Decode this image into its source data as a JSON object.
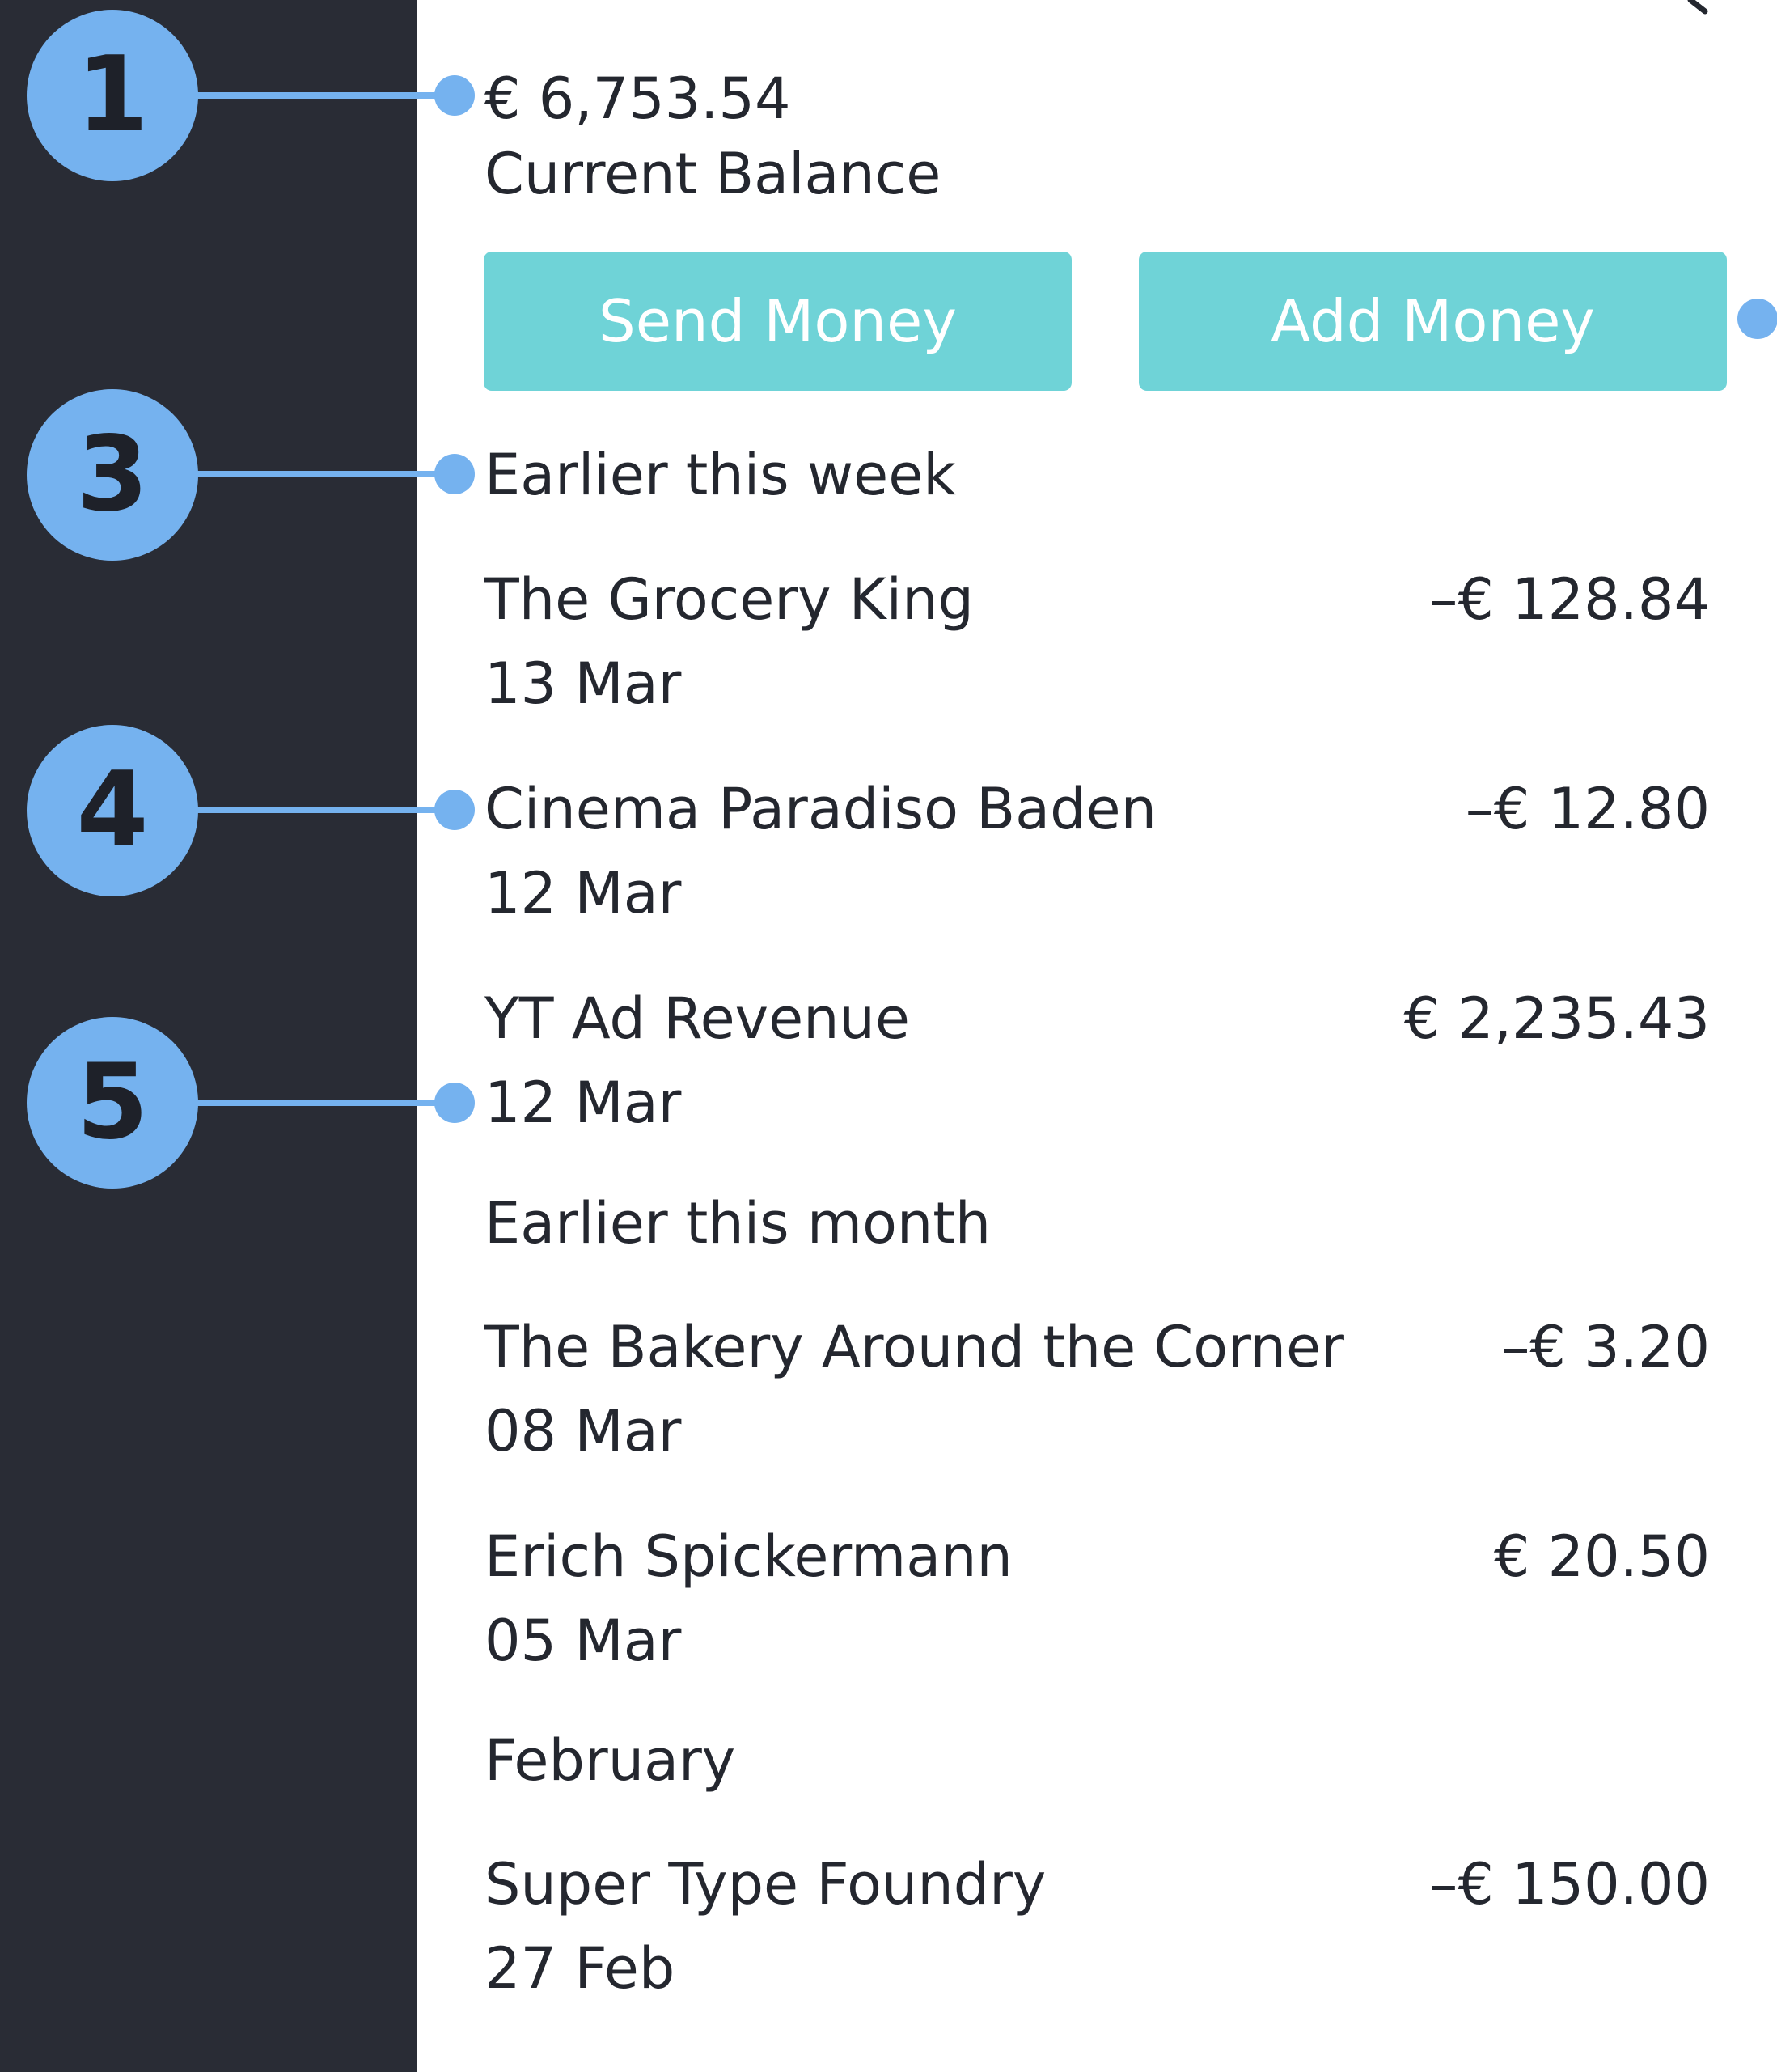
{
  "balance": {
    "amount": "€ 6,753.54",
    "label": "Current Balance"
  },
  "actions": {
    "send_label": "Send Money",
    "add_label": "Add Money"
  },
  "annotations": [
    "1",
    "3",
    "4",
    "5"
  ],
  "sections": [
    {
      "heading": "Earlier this week",
      "transactions": [
        {
          "name": "The Grocery King",
          "date": "13 Mar",
          "amount": "–€ 128.84"
        },
        {
          "name": "Cinema Paradiso Baden",
          "date": "12 Mar",
          "amount": "–€ 12.80"
        },
        {
          "name": "YT Ad Revenue",
          "date": "12 Mar",
          "amount": "€ 2,235.43"
        }
      ]
    },
    {
      "heading": "Earlier this month",
      "transactions": [
        {
          "name": "The Bakery Around the Corner",
          "date": "08 Mar",
          "amount": "–€ 3.20"
        },
        {
          "name": "Erich Spickermann",
          "date": "05 Mar",
          "amount": "€ 20.50"
        }
      ]
    },
    {
      "heading": "February",
      "transactions": [
        {
          "name": "Super Type Foundry",
          "date": "27 Feb",
          "amount": "–€ 150.00"
        }
      ]
    }
  ],
  "colors": {
    "sidebar": "#292c35",
    "accent": "#6fd3d7",
    "annotation": "#75b2ef",
    "text": "#24272f"
  },
  "icons": {
    "top_right": "search-icon"
  }
}
